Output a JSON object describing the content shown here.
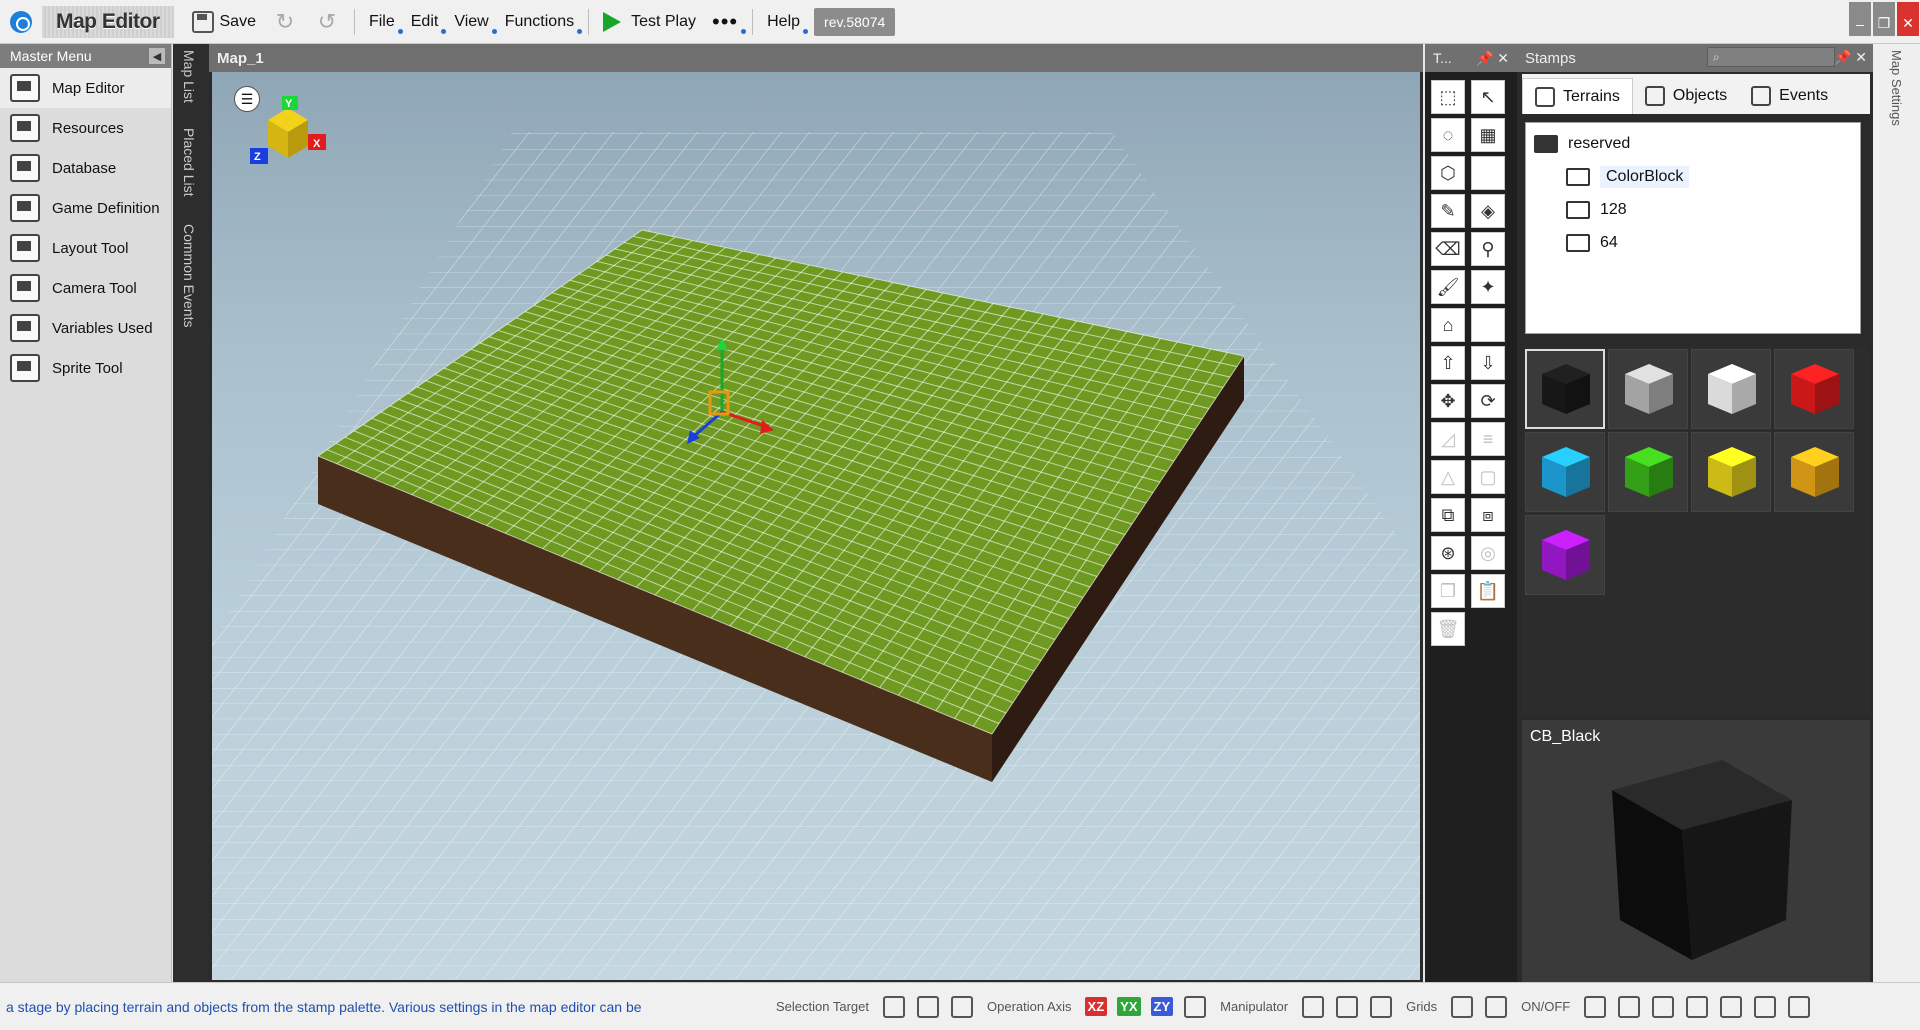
{
  "toolbar": {
    "app_title": "Map Editor",
    "save_label": "Save",
    "menu": [
      "File",
      "Edit",
      "View",
      "Functions"
    ],
    "test_play_label": "Test Play",
    "more_label": "•••",
    "help_label": "Help",
    "rev_label": "rev.58074"
  },
  "master_menu": {
    "title": "Master Menu",
    "items": [
      {
        "label": "Map Editor",
        "icon": "map-editor-icon"
      },
      {
        "label": "Resources",
        "icon": "resources-icon"
      },
      {
        "label": "Database",
        "icon": "database-icon"
      },
      {
        "label": "Game Definition",
        "icon": "game-definition-icon"
      },
      {
        "label": "Layout Tool",
        "icon": "layout-tool-icon"
      },
      {
        "label": "Camera Tool",
        "icon": "camera-tool-icon"
      },
      {
        "label": "Variables Used",
        "icon": "variables-used-icon"
      },
      {
        "label": "Sprite Tool",
        "icon": "sprite-tool-icon"
      }
    ]
  },
  "side_tabs": [
    "Map List",
    "Placed List",
    "Common Events"
  ],
  "viewport": {
    "title": "Map_1",
    "gizmo": {
      "y": "Y",
      "x": "X",
      "z": "Z"
    }
  },
  "tools_panel": {
    "title": "T..."
  },
  "stamps": {
    "title": "Stamps",
    "tabs": [
      "Terrains",
      "Objects",
      "Events"
    ],
    "tree": [
      {
        "label": "reserved",
        "level": 0
      },
      {
        "label": "ColorBlock",
        "level": 1
      },
      {
        "label": "128",
        "level": 1
      },
      {
        "label": "64",
        "level": 1
      }
    ],
    "swatch_colors": [
      "#1a1a1a",
      "#b5b5b5",
      "#f2f2f2",
      "#e01b1b",
      "#1fa6e0",
      "#39b21a",
      "#e3d01a",
      "#e8a617",
      "#a21ad6"
    ],
    "preview_title": "CB_Black"
  },
  "right_tab": "Map Settings",
  "status": {
    "message": "a stage by placing terrain and objects from the stamp palette.  Various settings in the map editor can be",
    "selection_target": "Selection Target",
    "operation_axis": "Operation Axis",
    "axes": [
      "XZ",
      "YX",
      "ZY"
    ],
    "manipulator": "Manipulator",
    "grids": "Grids",
    "on_off": "ON/OFF"
  },
  "colors": {
    "terrain_top": "#6f9a22",
    "terrain_side": "#4a2e1c",
    "accent": "#1a72d9"
  }
}
